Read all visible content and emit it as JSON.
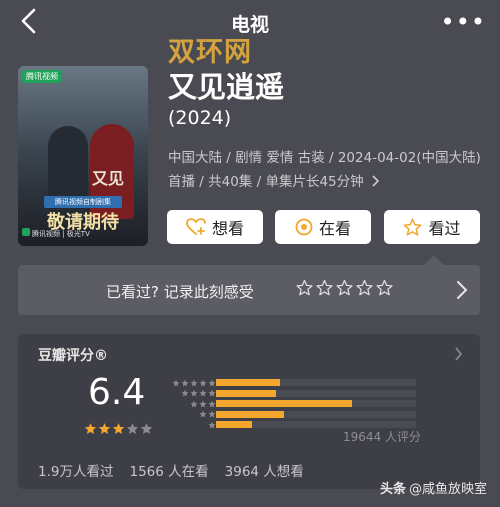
{
  "header": {
    "title": "电视",
    "more": "•••"
  },
  "watermark": "双环网",
  "poster": {
    "app_badge": "腾讯视频",
    "calligraphy": "又见",
    "tag": "腾讯视频自制剧集",
    "stay_tuned": "敬请期待",
    "platform": "腾讯视频 | 极光TV"
  },
  "show": {
    "name": "又见逍遥",
    "year": "(2024)",
    "meta": "中国大陆 / 剧情 爱情 古装 / 2024-04-02(中国大陆) 首播 / 共40集 / 单集片长45分钟"
  },
  "actions": {
    "want": "想看",
    "watching": "在看",
    "watched": "看过"
  },
  "review_prompt": {
    "text": "已看过? 记录此刻感受"
  },
  "douban": {
    "title": "豆瓣评分®",
    "score": "6.4",
    "score_stars": 3,
    "distribution_percent": {
      "5": 16,
      "4": 15,
      "3": 34,
      "2": 17,
      "1": 9
    },
    "rating_count": "19644 人评分",
    "stats": {
      "seen": "1.9万人看过",
      "watching": "1566 人在看",
      "want": "3964 人想看"
    }
  },
  "credit": {
    "platform": "头条",
    "author": "@咸鱼放映室"
  },
  "colors": {
    "accent": "#f3a72c",
    "background": "#4a4a52"
  }
}
